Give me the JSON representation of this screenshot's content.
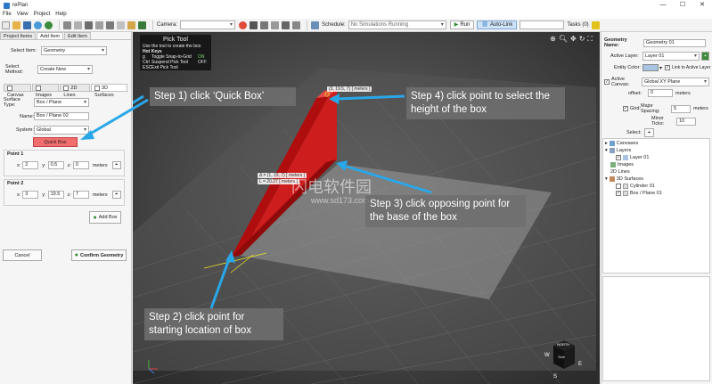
{
  "window": {
    "app_title": "rePlan",
    "minimize": "—",
    "maximize": "☐",
    "close": "✕"
  },
  "menu": [
    "File",
    "View",
    "Project",
    "Help"
  ],
  "toolbar": {
    "camera_label": "Camera:",
    "schedule_label": "Schedule:",
    "schedule_value": "No Simulations Running",
    "run_label": "Run",
    "autolink_label": "Auto-Link",
    "tasks_label": "Tasks (0)"
  },
  "left": {
    "top_tabs": [
      "Project Items",
      "Add Item",
      "Edit Item"
    ],
    "select_item_label": "Select Item:",
    "select_item_value": "Geometry",
    "select_method_label": "Select Method:",
    "select_method_value": "Create New",
    "sub_tabs": [
      "Canvas",
      "Images",
      "2D Lines",
      "3D Surfaces"
    ],
    "surface_type_label": "Surface Type:",
    "surface_type_value": "Box / Plane",
    "name_label": "Name:",
    "name_value": "Box / Plane 02",
    "system_label": "System:",
    "system_value": "Global",
    "quick_box_label": "Quick Box",
    "point1_title": "Point 1",
    "point1": {
      "x": "2",
      "y": "0.5",
      "z": "0"
    },
    "point2_title": "Point 2",
    "point2": {
      "x": "3",
      "y": "19.5",
      "z": "7"
    },
    "units": "meters",
    "x_label": "x:",
    "y_label": "y:",
    "z_label": "z:",
    "add_box_label": "Add Box",
    "cancel_label": "Cancel",
    "confirm_label": "Confirm Geometry"
  },
  "tooltip": {
    "title": "Pick Tool",
    "line1": "Use the tool to create the box",
    "hotkeys_title": "Hot Keys",
    "rows": [
      {
        "key": "g",
        "desc": "Toggle Snap-to-Grid",
        "state": "ON"
      },
      {
        "key": "Ctrl",
        "desc": "Suspend Pick Tool",
        "state": "OFF"
      },
      {
        "key": "ESC",
        "desc": "Exit Pick Tool",
        "state": ""
      }
    ]
  },
  "viewport": {
    "coord_top": "(3, 19.5, 7) [ meters ]",
    "coord_mid_1": "Δ = (1, 19, 7) [ meters ]",
    "coord_mid_2": "L = 20.27 [ meters ]",
    "cube_top": "NORTH",
    "cube_face": "Side",
    "compass_e": "E",
    "compass_w": "W",
    "compass_s": "S"
  },
  "callouts": {
    "step1": "Step 1) click ‘Quick Box’",
    "step2": "Step 2) click point for starting location of box",
    "step3": "Step 3) click opposing point for the base of the box",
    "step4": "Step 4) click point to select the height of the box"
  },
  "watermark": {
    "main": "闪电软件园",
    "sub": "www.sd173.com"
  },
  "right": {
    "geometry_name_label": "Geometry Name:",
    "geometry_name_value": "Geometry 01",
    "active_layer_label": "Active Layer:",
    "active_layer_value": "Layer 01",
    "entity_color_label": "Entity Color:",
    "link_label": "Link to Active Layer",
    "active_canvas_label": "Active Canvas:",
    "active_canvas_value": "Global XY Plane",
    "offset_label": "offset:",
    "offset_value": "0",
    "grid_label": "Grid:",
    "major_spacing_label": "Major Spacing:",
    "major_spacing_value": "5",
    "minor_ticks_label": "Minor Ticks:",
    "minor_ticks_value": "10",
    "select_label": "Select:",
    "units": "meters",
    "tree": {
      "canvases": "Canvases",
      "layers": "Layers",
      "layer01": "Layer 01",
      "images": "Images",
      "lines2d": "2D Lines",
      "surfaces3d": "3D Surfaces",
      "cylinder": "Cylinder 01",
      "boxplane": "Box / Plane 01"
    }
  },
  "colors": {
    "accent": "#2b78c8",
    "quickbox": "#f26d6d",
    "callout": "#6e6e6e",
    "arrow": "#2aa7e8",
    "box": "#c41414"
  }
}
